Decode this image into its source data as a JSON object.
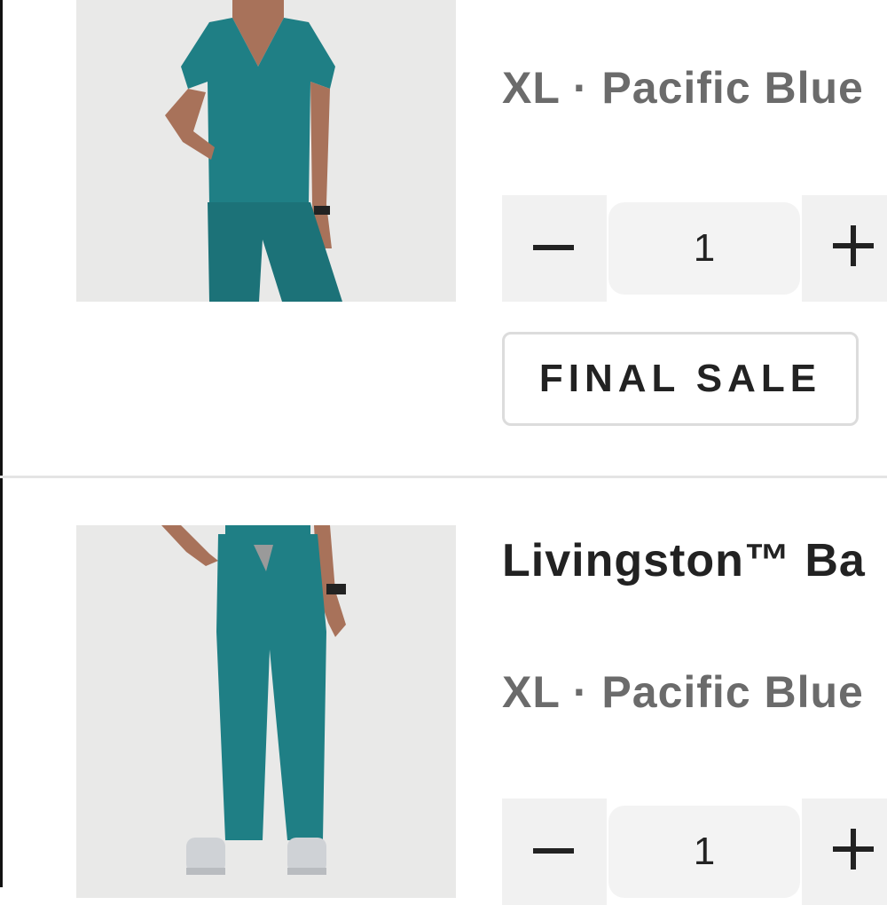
{
  "cart": {
    "items": [
      {
        "variant": "XL · Pacific Blue",
        "quantity": "1",
        "badge": "FINAL SALE"
      },
      {
        "title": "Livingston™ Ba",
        "variant": "XL · Pacific Blue",
        "quantity": "1"
      }
    ]
  },
  "colors": {
    "scrub_teal": "#1f7f85",
    "photo_background": "#e9e9e8",
    "variant_text": "#6b6b6b",
    "qty_background": "#f1f1f1",
    "divider": "#e4e4e4"
  },
  "icons": {
    "decrease": "minus-icon",
    "increase": "plus-icon"
  }
}
